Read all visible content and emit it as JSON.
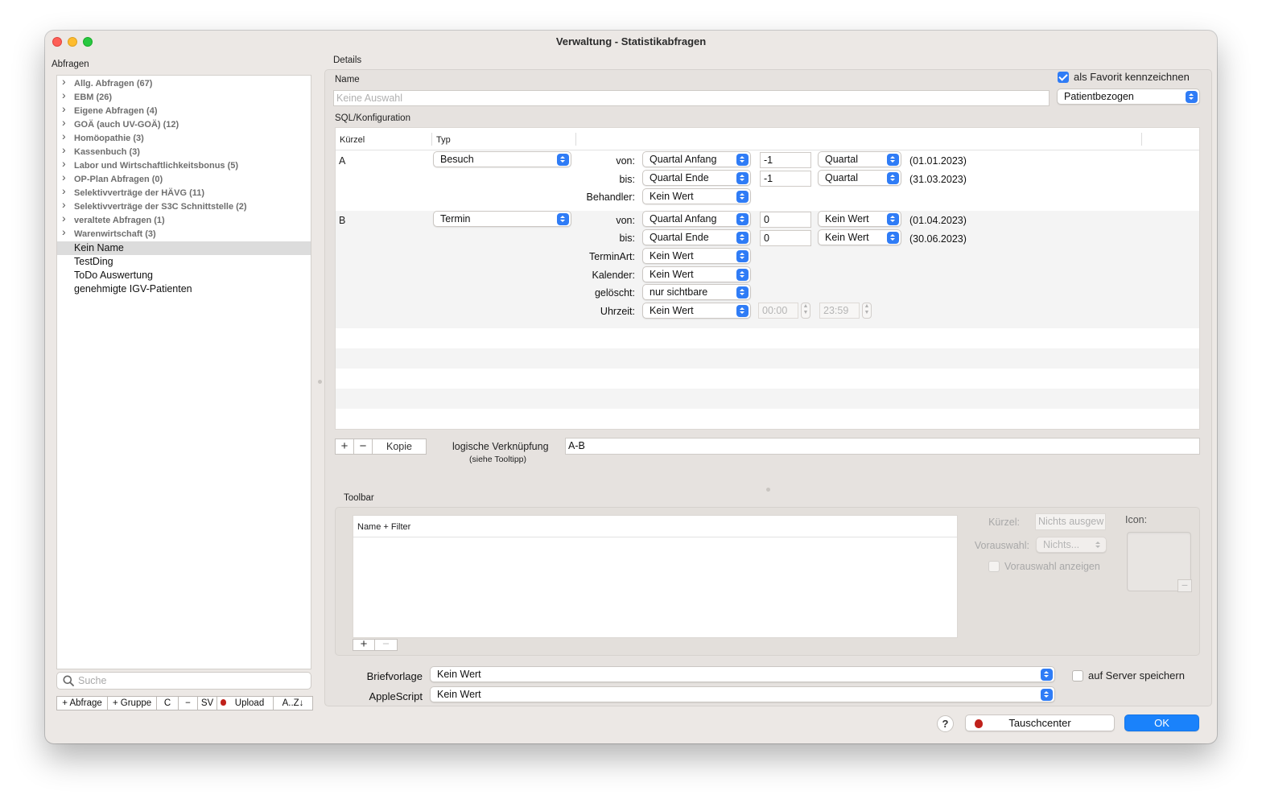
{
  "window": {
    "title": "Verwaltung - Statistikabfragen"
  },
  "left": {
    "heading": "Abfragen",
    "groups": [
      "Allg. Abfragen (67)",
      "EBM (26)",
      "Eigene Abfragen (4)",
      "GOÄ (auch UV-GOÄ) (12)",
      "Homöopathie (3)",
      "Kassenbuch (3)",
      "Labor und Wirtschaftlichkeitsbonus (5)",
      "OP-Plan Abfragen (0)",
      "Selektivverträge der HÄVG (11)",
      "Selektivverträge der S3C Schnittstelle (2)",
      "veraltete Abfragen (1)",
      "Warenwirtschaft (3)"
    ],
    "items": [
      "Kein Name",
      "TestDing",
      "ToDo Auswertung",
      "genehmigte IGV-Patienten"
    ],
    "search_placeholder": "Suche",
    "buttons": {
      "add_query": "+ Abfrage",
      "add_group": "+ Gruppe",
      "copy": "C",
      "remove": "−",
      "sv": "SV",
      "upload": "Upload",
      "sort": "A..Z↓"
    }
  },
  "details": {
    "heading": "Details",
    "name_label": "Name",
    "name_placeholder": "Keine Auswahl",
    "favorite_label": "als Favorit kennzeichnen",
    "favorite_checked": true,
    "scope_value": "Patientbezogen",
    "sql_label": "SQL/Konfiguration",
    "table": {
      "col_kuerzel": "Kürzel",
      "col_typ": "Typ",
      "rowA": {
        "kuerzel": "A",
        "typ": "Besuch",
        "von_label": "von:",
        "von_select": "Quartal Anfang",
        "von_num": "-1",
        "von_unit": "Quartal",
        "von_date": "(01.01.2023)",
        "bis_label": "bis:",
        "bis_select": "Quartal Ende",
        "bis_num": "-1",
        "bis_unit": "Quartal",
        "bis_date": "(31.03.2023)",
        "behandler_label": "Behandler:",
        "behandler_value": "Kein Wert"
      },
      "rowB": {
        "kuerzel": "B",
        "typ": "Termin",
        "von_label": "von:",
        "von_select": "Quartal Anfang",
        "von_num": "0",
        "von_unit": "Kein Wert",
        "von_date": "(01.04.2023)",
        "bis_label": "bis:",
        "bis_select": "Quartal Ende",
        "bis_num": "0",
        "bis_unit": "Kein Wert",
        "bis_date": "(30.06.2023)",
        "terminart_label": "TerminArt:",
        "terminart_value": "Kein Wert",
        "kalender_label": "Kalender:",
        "kalender_value": "Kein Wert",
        "geloescht_label": "gelöscht:",
        "geloescht_value": "nur sichtbare",
        "uhrzeit_label": "Uhrzeit:",
        "uhrzeit_value": "Kein Wert",
        "uhrzeit_from": "00:00",
        "uhrzeit_to": "23:59"
      }
    },
    "add": "+",
    "remove": "−",
    "copy": "Kopie",
    "logic_label": "logische Verknüpfung",
    "logic_hint": "(siehe Tooltipp)",
    "logic_value": "A-B"
  },
  "toolbar": {
    "heading": "Toolbar",
    "col_name": "Name + Filter",
    "add": "+",
    "remove": "−",
    "kuerzel_label": "Kürzel:",
    "kuerzel_placeholder": "Nichts ausgew",
    "vorauswahl_label": "Vorauswahl:",
    "vorauswahl_value": "Nichts...",
    "vorauswahl_show_label": "Vorauswahl anzeigen",
    "icon_label": "Icon:"
  },
  "bottom": {
    "briefvorlage_label": "Briefvorlage",
    "briefvorlage_value": "Kein Wert",
    "applescript_label": "AppleScript",
    "applescript_value": "Kein Wert",
    "server_label": "auf Server speichern",
    "help": "?",
    "tauschcenter": "Tauschcenter",
    "ok": "OK"
  },
  "colors": {
    "accent": "#1a82fb",
    "selection": "#dcdcdc",
    "window_bg": "#ece8e5"
  },
  "icons": [
    "search-icon",
    "chevron-right-icon",
    "apple-icon",
    "help-icon"
  ]
}
